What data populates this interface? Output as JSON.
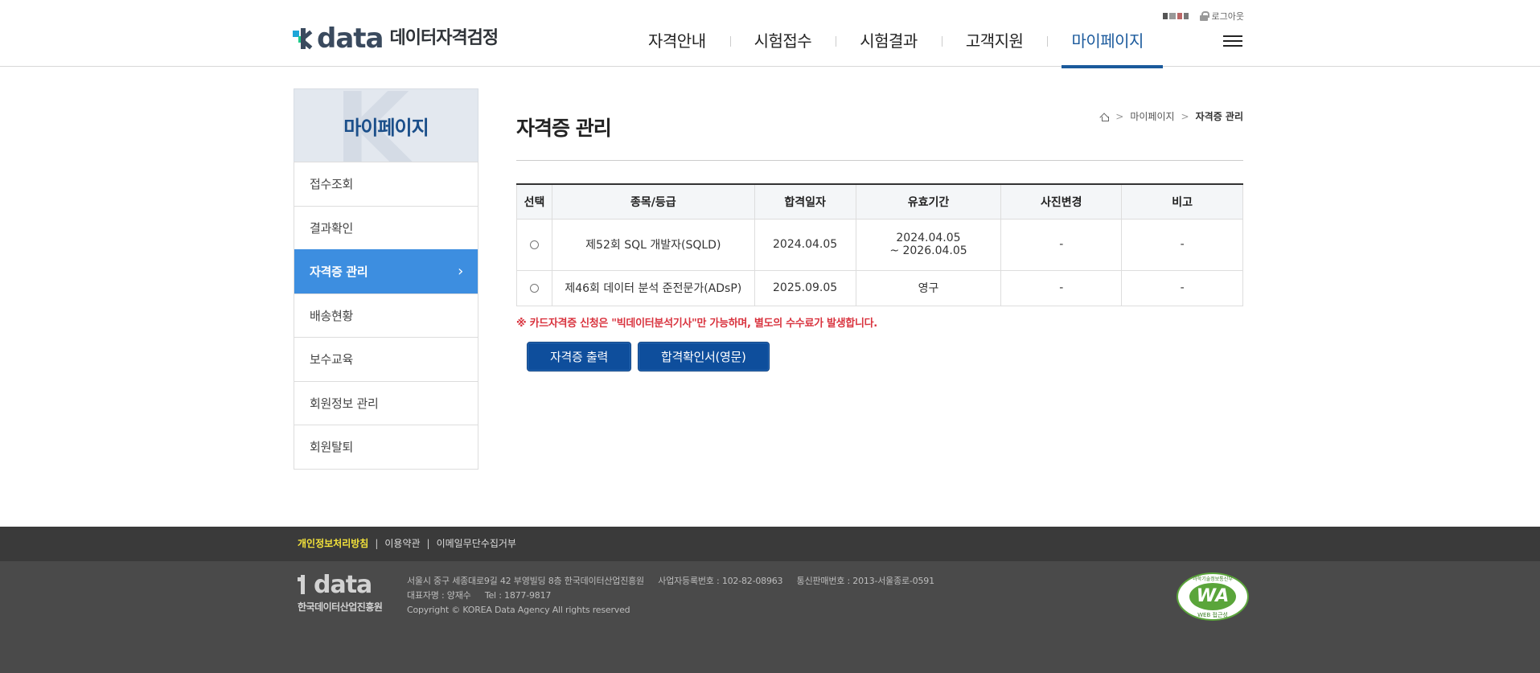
{
  "header": {
    "logo_word": "data",
    "logo_sub": "데이터자격검정",
    "logout_label": "로그아웃",
    "nav": [
      "자격안내",
      "시험접수",
      "시험결과",
      "고객지원",
      "마이페이지"
    ],
    "active_nav": "마이페이지"
  },
  "sidebar": {
    "title": "마이페이지",
    "items": [
      {
        "label": "접수조회"
      },
      {
        "label": "결과확인"
      },
      {
        "label": "자격증 관리"
      },
      {
        "label": "배송현황"
      },
      {
        "label": "보수교육"
      },
      {
        "label": "회원정보 관리"
      },
      {
        "label": "회원탈퇴"
      }
    ],
    "active_item": "자격증 관리"
  },
  "main": {
    "page_title": "자격증 관리",
    "breadcrumb": [
      "마이페이지",
      "자격증 관리"
    ],
    "table": {
      "headers": [
        "선택",
        "종목/등급",
        "합격일자",
        "유효기간",
        "사진변경",
        "비고"
      ],
      "rows": [
        {
          "subject": "제52회 SQL 개발자(SQLD)",
          "pass_date": "2024.04.05",
          "valid_from": "2024.04.05",
          "valid_to": "~ 2026.04.05",
          "photo": "-",
          "note": "-"
        },
        {
          "subject": "제46회 데이터 분석 준전문가(ADsP)",
          "pass_date": "2025.09.05",
          "valid_from": "영구",
          "valid_to": "",
          "photo": "-",
          "note": "-"
        }
      ]
    },
    "notice": "※ 카드자격증 신청은 \"빅데이터분석기사\"만 가능하며, 별도의 수수료가 발생합니다.",
    "buttons": {
      "print_cert": "자격증 출력",
      "pass_confirm_en": "합격확인서(영문)"
    }
  },
  "footer": {
    "links": [
      "개인정보처리방침",
      "이용약관",
      "이메일무단수집거부"
    ],
    "logo_word": "data",
    "logo_sub": "한국데이터산업진흥원",
    "address": "서울시 중구 세종대로9길 42 부영빌딩 8층 한국데이터산업진흥원",
    "biz_no": "사업자등록번호 : 102-82-08963",
    "mail_order_no": "통신판매번호 : 2013-서울종로-0591",
    "ceo": "대표자명 : 양재수",
    "tel": "Tel : 1877-9817",
    "copyright": "Copyright © KOREA Data Agency All rights reserved",
    "badge_main": "WA",
    "badge_top": "과학기술정보통신부",
    "badge_sub": "WEB 접근성"
  },
  "colors": {
    "primary": "#1b5a9c",
    "sidebar_active": "#3d8ee0",
    "button": "#0e4e9c",
    "notice": "#d9343f",
    "footer_link_highlight": "#f3e23a"
  },
  "icons": [
    "home-icon",
    "lock-icon",
    "hamburger-menu-icon",
    "chevron-right-icon",
    "radio-button"
  ]
}
